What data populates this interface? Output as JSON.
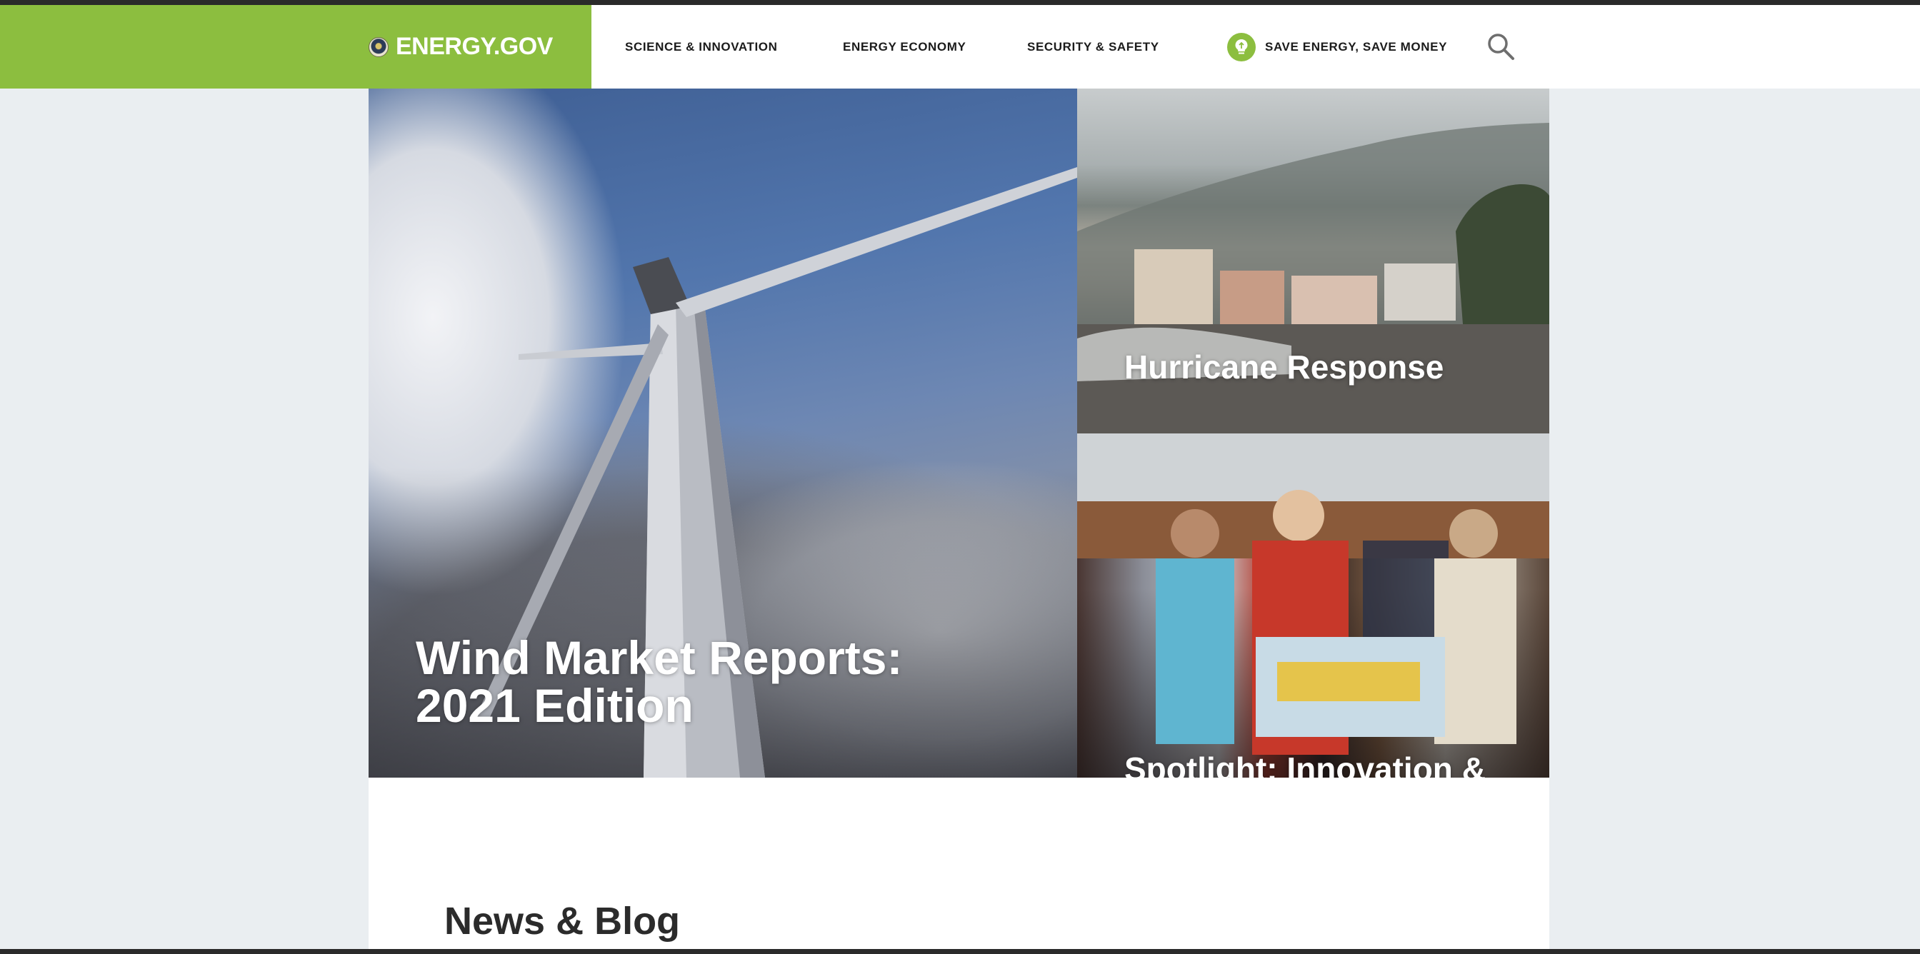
{
  "header": {
    "logo_text": "ENERGY.GOV",
    "nav": [
      {
        "label": "SCIENCE & INNOVATION"
      },
      {
        "label": "ENERGY ECONOMY"
      },
      {
        "label": "SECURITY & SAFETY"
      },
      {
        "label": "SAVE ENERGY, SAVE MONEY",
        "icon": "lightbulb-icon"
      }
    ],
    "search_icon": "search-icon"
  },
  "hero": {
    "cards": [
      {
        "title": "Wind Market Reports: 2021 Edition",
        "image": "wind-turbine-photo"
      },
      {
        "title": "Hurricane Response",
        "image": "coastal-town-storm-photo"
      },
      {
        "title": "Spotlight: Innovation & Energy Justice",
        "image": "press-event-photo"
      }
    ]
  },
  "news": {
    "heading": "News & Blog"
  },
  "colors": {
    "brand_green": "#8cbe3f",
    "page_background": "#eaeef1",
    "nav_text": "#1b1b1b"
  }
}
